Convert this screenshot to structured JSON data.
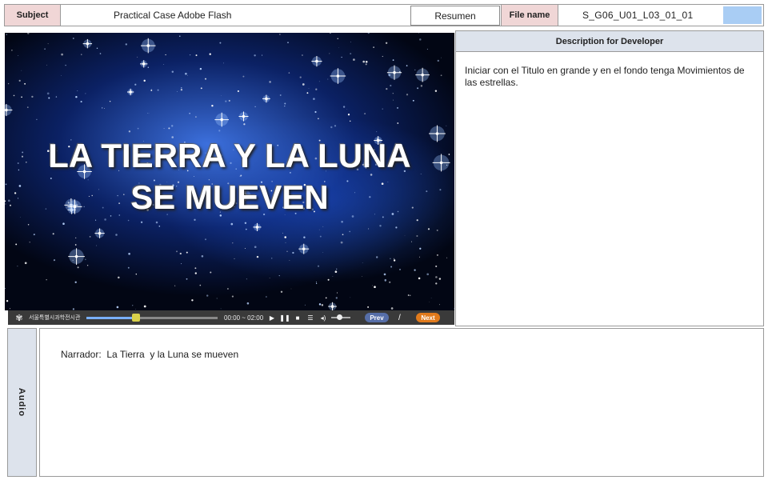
{
  "header": {
    "subject_label": "Subject",
    "subject_value": "Practical Case Adobe Flash",
    "resumen_label": "Resumen",
    "file_label": "File name",
    "file_value": "S_G06_U01_L03_01_01",
    "swatch_color": "#a9cdf4"
  },
  "slide": {
    "title": "LA TIERRA Y LA LUNA\nSE MUEVEN"
  },
  "player": {
    "org_name": "서울특별시과학전시관",
    "progress": 0.38,
    "time": "00:00 ~ 02:00",
    "play_icon": "play-icon",
    "pause_icon": "pause-icon",
    "stop_icon": "stop-icon",
    "list_icon": "list-icon",
    "volume_icon": "volume-icon",
    "volume_level": 0.4,
    "prev_label": "Prev",
    "separator": "/",
    "next_label": "Next"
  },
  "description": {
    "heading": "Description for Developer",
    "text": "Iniciar con el Titulo en grande y en el fondo tenga Movimientos de las estrellas."
  },
  "audio": {
    "label": "Audio",
    "text": "Narrador:  La Tierra  y la Luna se mueven"
  }
}
